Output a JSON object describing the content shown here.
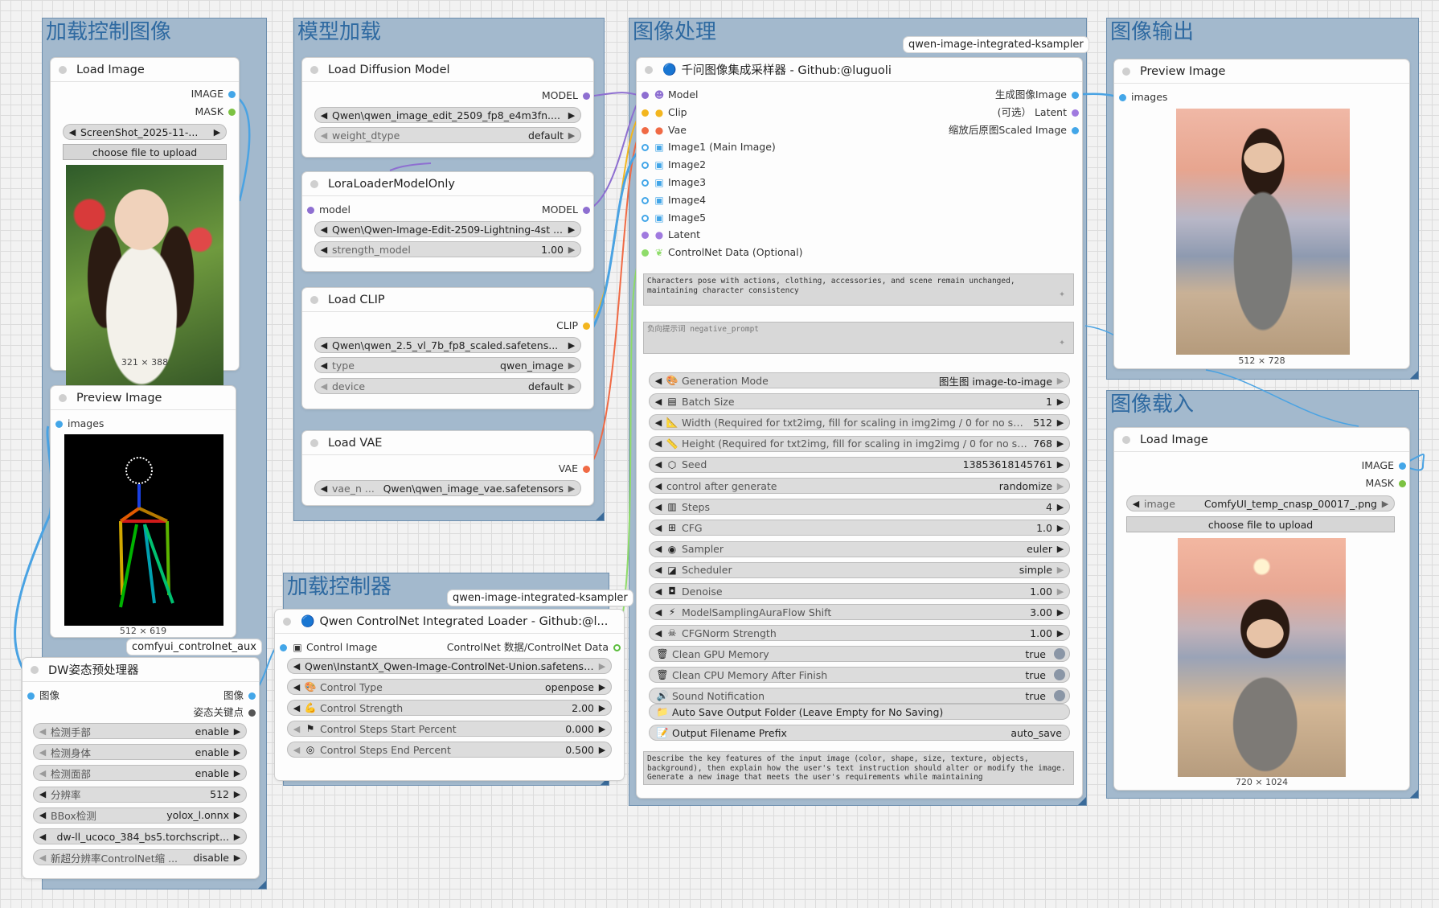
{
  "groups": {
    "load_control_image": "加载控制图像",
    "model_loading": "模型加载",
    "image_processing": "图像处理",
    "image_output": "图像输出",
    "load_controller": "加载控制器",
    "image_load_in": "图像载入"
  },
  "badges": {
    "sampler_badge": "qwen-image-integrated-ksampler",
    "controlnet_badge": "qwen-image-integrated-ksampler",
    "aux_badge": "comfyui_controlnet_aux"
  },
  "load_image_1": {
    "title": "Load Image",
    "out_image": "IMAGE",
    "out_mask": "MASK",
    "file": "ScreenShot_2025-11-...",
    "upload": "choose file to upload",
    "size": "321 × 388"
  },
  "preview_image_1": {
    "title": "Preview Image",
    "in_images": "images",
    "size": "512 × 619"
  },
  "dw_pose": {
    "title": "DW姿态预处理器",
    "in_image": "图像",
    "out_image": "图像",
    "out_keypoints": "姿态关键点",
    "widgets": [
      {
        "label": "检测手部",
        "value": "enable"
      },
      {
        "label": "检测身体",
        "value": "enable"
      },
      {
        "label": "检测面部",
        "value": "enable"
      },
      {
        "label": "分辨率",
        "value": "512"
      },
      {
        "label": "BBox检测",
        "value": "yolox_l.onnx"
      },
      {
        "label": "",
        "value": "dw-ll_ucoco_384_bs5.torchscript..."
      },
      {
        "label": "新超分辨率ControlNet缩 ...",
        "value": "disable"
      }
    ]
  },
  "load_diffusion": {
    "title": "Load Diffusion Model",
    "out_model": "MODEL",
    "unet_name": "Qwen\\qwen_image_edit_2509_fp8_e4m3fn....",
    "weight_label": "weight_dtype",
    "weight_value": "default"
  },
  "lora_loader": {
    "title": "LoraLoaderModelOnly",
    "in_model": "model",
    "out_model": "MODEL",
    "lora_name": "Qwen\\Qwen-Image-Edit-2509-Lightning-4st ...",
    "strength_label": "strength_model",
    "strength_value": "1.00"
  },
  "load_clip": {
    "title": "Load CLIP",
    "out_clip": "CLIP",
    "clip_name": "Qwen\\qwen_2.5_vl_7b_fp8_scaled.safetens...",
    "type_label": "type",
    "type_value": "qwen_image",
    "device_label": "device",
    "device_value": "default"
  },
  "load_vae": {
    "title": "Load VAE",
    "out_vae": "VAE",
    "vae_label": "vae_n ...",
    "vae_value": "Qwen\\qwen_image_vae.safetensors"
  },
  "controlnet_loader": {
    "title": "Qwen ControlNet Integrated Loader - Github:@l...",
    "in_control_image": "Control Image",
    "out_data": "ControlNet 数据/ControlNet Data",
    "model_value": "Qwen\\InstantX_Qwen-Image-ControlNet-Union.safetens ...",
    "widgets": [
      {
        "icon": "palette-icon",
        "glyph": "🎨",
        "label": "Control Type",
        "value": "openpose"
      },
      {
        "icon": "muscle-icon",
        "glyph": "💪",
        "label": "Control Strength",
        "value": "2.00"
      },
      {
        "icon": "flag-icon",
        "glyph": "⚑",
        "label": "Control Steps Start Percent",
        "value": "0.000"
      },
      {
        "icon": "target-icon",
        "glyph": "◎",
        "label": "Control Steps End Percent",
        "value": "0.500"
      }
    ]
  },
  "sampler": {
    "title": "千问图像集成采样器 - Github:@luguoli",
    "inputs": [
      {
        "icon": "model-icon",
        "glyph": "☻",
        "label": "Model",
        "color": "#8e6fd1"
      },
      {
        "icon": "clip-icon",
        "glyph": "●",
        "label": "Clip",
        "color": "#f3b61f"
      },
      {
        "icon": "vae-icon",
        "glyph": "●",
        "label": "Vae",
        "color": "#f06a45"
      },
      {
        "icon": "image-icon",
        "glyph": "▣",
        "label": "Image1 (Main Image)",
        "color": "#43a6e8"
      },
      {
        "icon": "image-icon",
        "glyph": "▣",
        "label": "Image2",
        "color": "#43a6e8"
      },
      {
        "icon": "image-icon",
        "glyph": "▣",
        "label": "Image3",
        "color": "#43a6e8"
      },
      {
        "icon": "image-icon",
        "glyph": "▣",
        "label": "Image4",
        "color": "#43a6e8"
      },
      {
        "icon": "image-icon",
        "glyph": "▣",
        "label": "Image5",
        "color": "#43a6e8"
      },
      {
        "icon": "latent-icon",
        "glyph": "●",
        "label": "Latent",
        "color": "#a07adf"
      },
      {
        "icon": "leaf-icon",
        "glyph": "❦",
        "label": "ControlNet Data (Optional)",
        "color": "#8fdc6a"
      }
    ],
    "outputs": [
      {
        "label": "生成图像Image",
        "color": "#43a6e8"
      },
      {
        "label": "(可选） Latent",
        "color": "#a07adf"
      },
      {
        "label": "缩放后原图Scaled Image",
        "color": "#43a6e8"
      }
    ],
    "positive_prompt": "Characters pose with actions, clothing, accessories, and scene remain unchanged, maintaining character consistency",
    "negative_placeholder": "负向提示词 negative_prompt",
    "widgets": [
      {
        "icon": "palette-icon",
        "glyph": "🎨",
        "label": "Generation Mode",
        "value": "图生图 image-to-image"
      },
      {
        "icon": "stack-icon",
        "glyph": "▤",
        "label": "Batch Size",
        "value": "1"
      },
      {
        "icon": "ruler-icon",
        "glyph": "📐",
        "label": "Width (Required for txt2img, fill for scaling in img2img / 0 for no scalin ...",
        "value": "512"
      },
      {
        "icon": "pencil-ruler-icon",
        "glyph": "📏",
        "label": "Height (Required for txt2img, fill for scaling in img2img / 0 for no scali ...",
        "value": "768"
      },
      {
        "icon": "seed-icon",
        "glyph": "⬡",
        "label": "Seed",
        "value": "13853618145761"
      },
      {
        "icon": "",
        "glyph": "",
        "label": "control after generate",
        "value": "randomize"
      },
      {
        "icon": "steps-icon",
        "glyph": "▥",
        "label": "Steps",
        "value": "4"
      },
      {
        "icon": "grid-icon",
        "glyph": "⊞",
        "label": "CFG",
        "value": "1.0"
      },
      {
        "icon": "sampler-icon",
        "glyph": "◉",
        "label": "Sampler",
        "value": "euler"
      },
      {
        "icon": "chart-icon",
        "glyph": "◪",
        "label": "Scheduler",
        "value": "simple"
      },
      {
        "icon": "denoise-icon",
        "glyph": "◘",
        "label": "Denoise",
        "value": "1.00"
      },
      {
        "icon": "lightning-icon",
        "glyph": "⚡",
        "label": "ModelSamplingAuraFlow Shift",
        "value": "3.00"
      },
      {
        "icon": "skull-icon",
        "glyph": "☠",
        "label": "CFGNorm Strength",
        "value": "1.00"
      }
    ],
    "toggles": [
      {
        "icon": "trash-icon",
        "glyph": "🗑",
        "label": "Clean GPU Memory",
        "value": "true"
      },
      {
        "icon": "trash-icon",
        "glyph": "🗑",
        "label": "Clean CPU Memory After Finish",
        "value": "true"
      },
      {
        "icon": "speaker-icon",
        "glyph": "🔊",
        "label": "Sound Notification",
        "value": "true"
      }
    ],
    "save_folder": {
      "icon": "folder-icon",
      "glyph": "📁",
      "label": "Auto Save Output Folder (Leave Empty for No Saving)",
      "value": ""
    },
    "filename_prefix": {
      "icon": "note-icon",
      "glyph": "📝",
      "label": "Output Filename Prefix",
      "value": "auto_save"
    },
    "system_prompt": "Describe the key features of the input image (color, shape, size, texture, objects, background), then explain how the user's text instruction should alter or modify the image. Generate a new image that meets the user's requirements while maintaining"
  },
  "preview_image_2": {
    "title": "Preview Image",
    "in_images": "images",
    "size": "512 × 728"
  },
  "load_image_2": {
    "title": "Load Image",
    "out_image": "IMAGE",
    "out_mask": "MASK",
    "image_label": "image",
    "image_value": "ComfyUI_temp_cnasp_00017_.png",
    "upload": "choose file to upload",
    "size": "720 × 1024"
  },
  "colors": {
    "image": "#43a6e8",
    "mask": "#7cc242",
    "model": "#8e6fd1",
    "clip": "#f3b61f",
    "vae": "#f06a45",
    "latent": "#a07adf",
    "controlnet": "#8fdc6a",
    "group_bg": "#a3b9cd",
    "group_title": "#2f6aa1"
  }
}
